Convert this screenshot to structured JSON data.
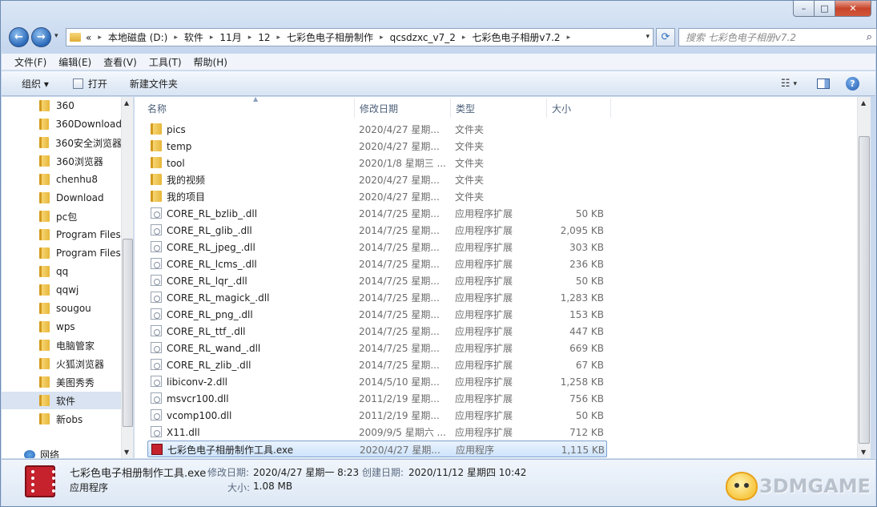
{
  "window": {
    "caption": {
      "minimize": "–",
      "maximize": "□",
      "close": "✕"
    }
  },
  "address": {
    "overflow": "«",
    "crumbs": [
      "本地磁盘 (D:)",
      "软件",
      "11月",
      "12",
      "七彩色电子相册制作",
      "qcsdzxc_v7_2",
      "七彩色电子相册v7.2"
    ],
    "search_placeholder": "搜索 七彩色电子相册v7.2"
  },
  "menu": [
    "文件(F)",
    "编辑(E)",
    "查看(V)",
    "工具(T)",
    "帮助(H)"
  ],
  "toolbar": {
    "organize": "组织 ▾",
    "open": "打开",
    "new_folder": "新建文件夹"
  },
  "sidebar": {
    "items": [
      {
        "label": "360"
      },
      {
        "label": "360Download"
      },
      {
        "label": "360安全浏览器"
      },
      {
        "label": "360浏览器"
      },
      {
        "label": "chenhu8"
      },
      {
        "label": "Download"
      },
      {
        "label": "pc包"
      },
      {
        "label": "Program Files"
      },
      {
        "label": "Program Files"
      },
      {
        "label": "qq"
      },
      {
        "label": "qqwj"
      },
      {
        "label": "sougou"
      },
      {
        "label": "wps"
      },
      {
        "label": "电脑管家"
      },
      {
        "label": "火狐浏览器"
      },
      {
        "label": "美图秀秀"
      },
      {
        "label": "软件",
        "selected": true
      },
      {
        "label": "新obs"
      }
    ],
    "network": "网络"
  },
  "columns": {
    "name": "名称",
    "date": "修改日期",
    "type": "类型",
    "size": "大小"
  },
  "files": [
    {
      "icon": "folder-icon",
      "name": "pics",
      "date": "2020/4/27 星期...",
      "type": "文件夹",
      "size": ""
    },
    {
      "icon": "folder-icon",
      "name": "temp",
      "date": "2020/4/27 星期...",
      "type": "文件夹",
      "size": ""
    },
    {
      "icon": "folder-icon",
      "name": "tool",
      "date": "2020/1/8 星期三 ...",
      "type": "文件夹",
      "size": ""
    },
    {
      "icon": "folder-icon",
      "name": "我的视频",
      "date": "2020/4/27 星期...",
      "type": "文件夹",
      "size": ""
    },
    {
      "icon": "folder-icon",
      "name": "我的项目",
      "date": "2020/4/27 星期...",
      "type": "文件夹",
      "size": ""
    },
    {
      "icon": "dll-icon",
      "name": "CORE_RL_bzlib_.dll",
      "date": "2014/7/25 星期...",
      "type": "应用程序扩展",
      "size": "50 KB"
    },
    {
      "icon": "dll-icon",
      "name": "CORE_RL_glib_.dll",
      "date": "2014/7/25 星期...",
      "type": "应用程序扩展",
      "size": "2,095 KB"
    },
    {
      "icon": "dll-icon",
      "name": "CORE_RL_jpeg_.dll",
      "date": "2014/7/25 星期...",
      "type": "应用程序扩展",
      "size": "303 KB"
    },
    {
      "icon": "dll-icon",
      "name": "CORE_RL_lcms_.dll",
      "date": "2014/7/25 星期...",
      "type": "应用程序扩展",
      "size": "236 KB"
    },
    {
      "icon": "dll-icon",
      "name": "CORE_RL_lqr_.dll",
      "date": "2014/7/25 星期...",
      "type": "应用程序扩展",
      "size": "50 KB"
    },
    {
      "icon": "dll-icon",
      "name": "CORE_RL_magick_.dll",
      "date": "2014/7/25 星期...",
      "type": "应用程序扩展",
      "size": "1,283 KB"
    },
    {
      "icon": "dll-icon",
      "name": "CORE_RL_png_.dll",
      "date": "2014/7/25 星期...",
      "type": "应用程序扩展",
      "size": "153 KB"
    },
    {
      "icon": "dll-icon",
      "name": "CORE_RL_ttf_.dll",
      "date": "2014/7/25 星期...",
      "type": "应用程序扩展",
      "size": "447 KB"
    },
    {
      "icon": "dll-icon",
      "name": "CORE_RL_wand_.dll",
      "date": "2014/7/25 星期...",
      "type": "应用程序扩展",
      "size": "669 KB"
    },
    {
      "icon": "dll-icon",
      "name": "CORE_RL_zlib_.dll",
      "date": "2014/7/25 星期...",
      "type": "应用程序扩展",
      "size": "67 KB"
    },
    {
      "icon": "dll-icon",
      "name": "libiconv-2.dll",
      "date": "2014/5/10 星期...",
      "type": "应用程序扩展",
      "size": "1,258 KB"
    },
    {
      "icon": "dll-icon",
      "name": "msvcr100.dll",
      "date": "2011/2/19 星期...",
      "type": "应用程序扩展",
      "size": "756 KB"
    },
    {
      "icon": "dll-icon",
      "name": "vcomp100.dll",
      "date": "2011/2/19 星期...",
      "type": "应用程序扩展",
      "size": "50 KB"
    },
    {
      "icon": "dll-icon",
      "name": "X11.dll",
      "date": "2009/9/5 星期六 ...",
      "type": "应用程序扩展",
      "size": "712 KB"
    },
    {
      "icon": "exe-icon",
      "name": "七彩色电子相册制作工具.exe",
      "date": "2020/4/27 星期...",
      "type": "应用程序",
      "size": "1,115 KB",
      "selected": true
    }
  ],
  "details": {
    "name": "七彩色电子相册制作工具.exe",
    "modified_label": "修改日期:",
    "modified_value": "2020/4/27 星期一 8:23",
    "created_label": "创建日期:",
    "created_value": "2020/11/12 星期四 10:42",
    "type": "应用程序",
    "size_label": "大小:",
    "size_value": "1.08 MB"
  },
  "watermark": "3DMGAME",
  "colors": {
    "selection": "#cde3fb",
    "selection_border": "#7da2ce",
    "exe_icon": "#c5222d"
  }
}
